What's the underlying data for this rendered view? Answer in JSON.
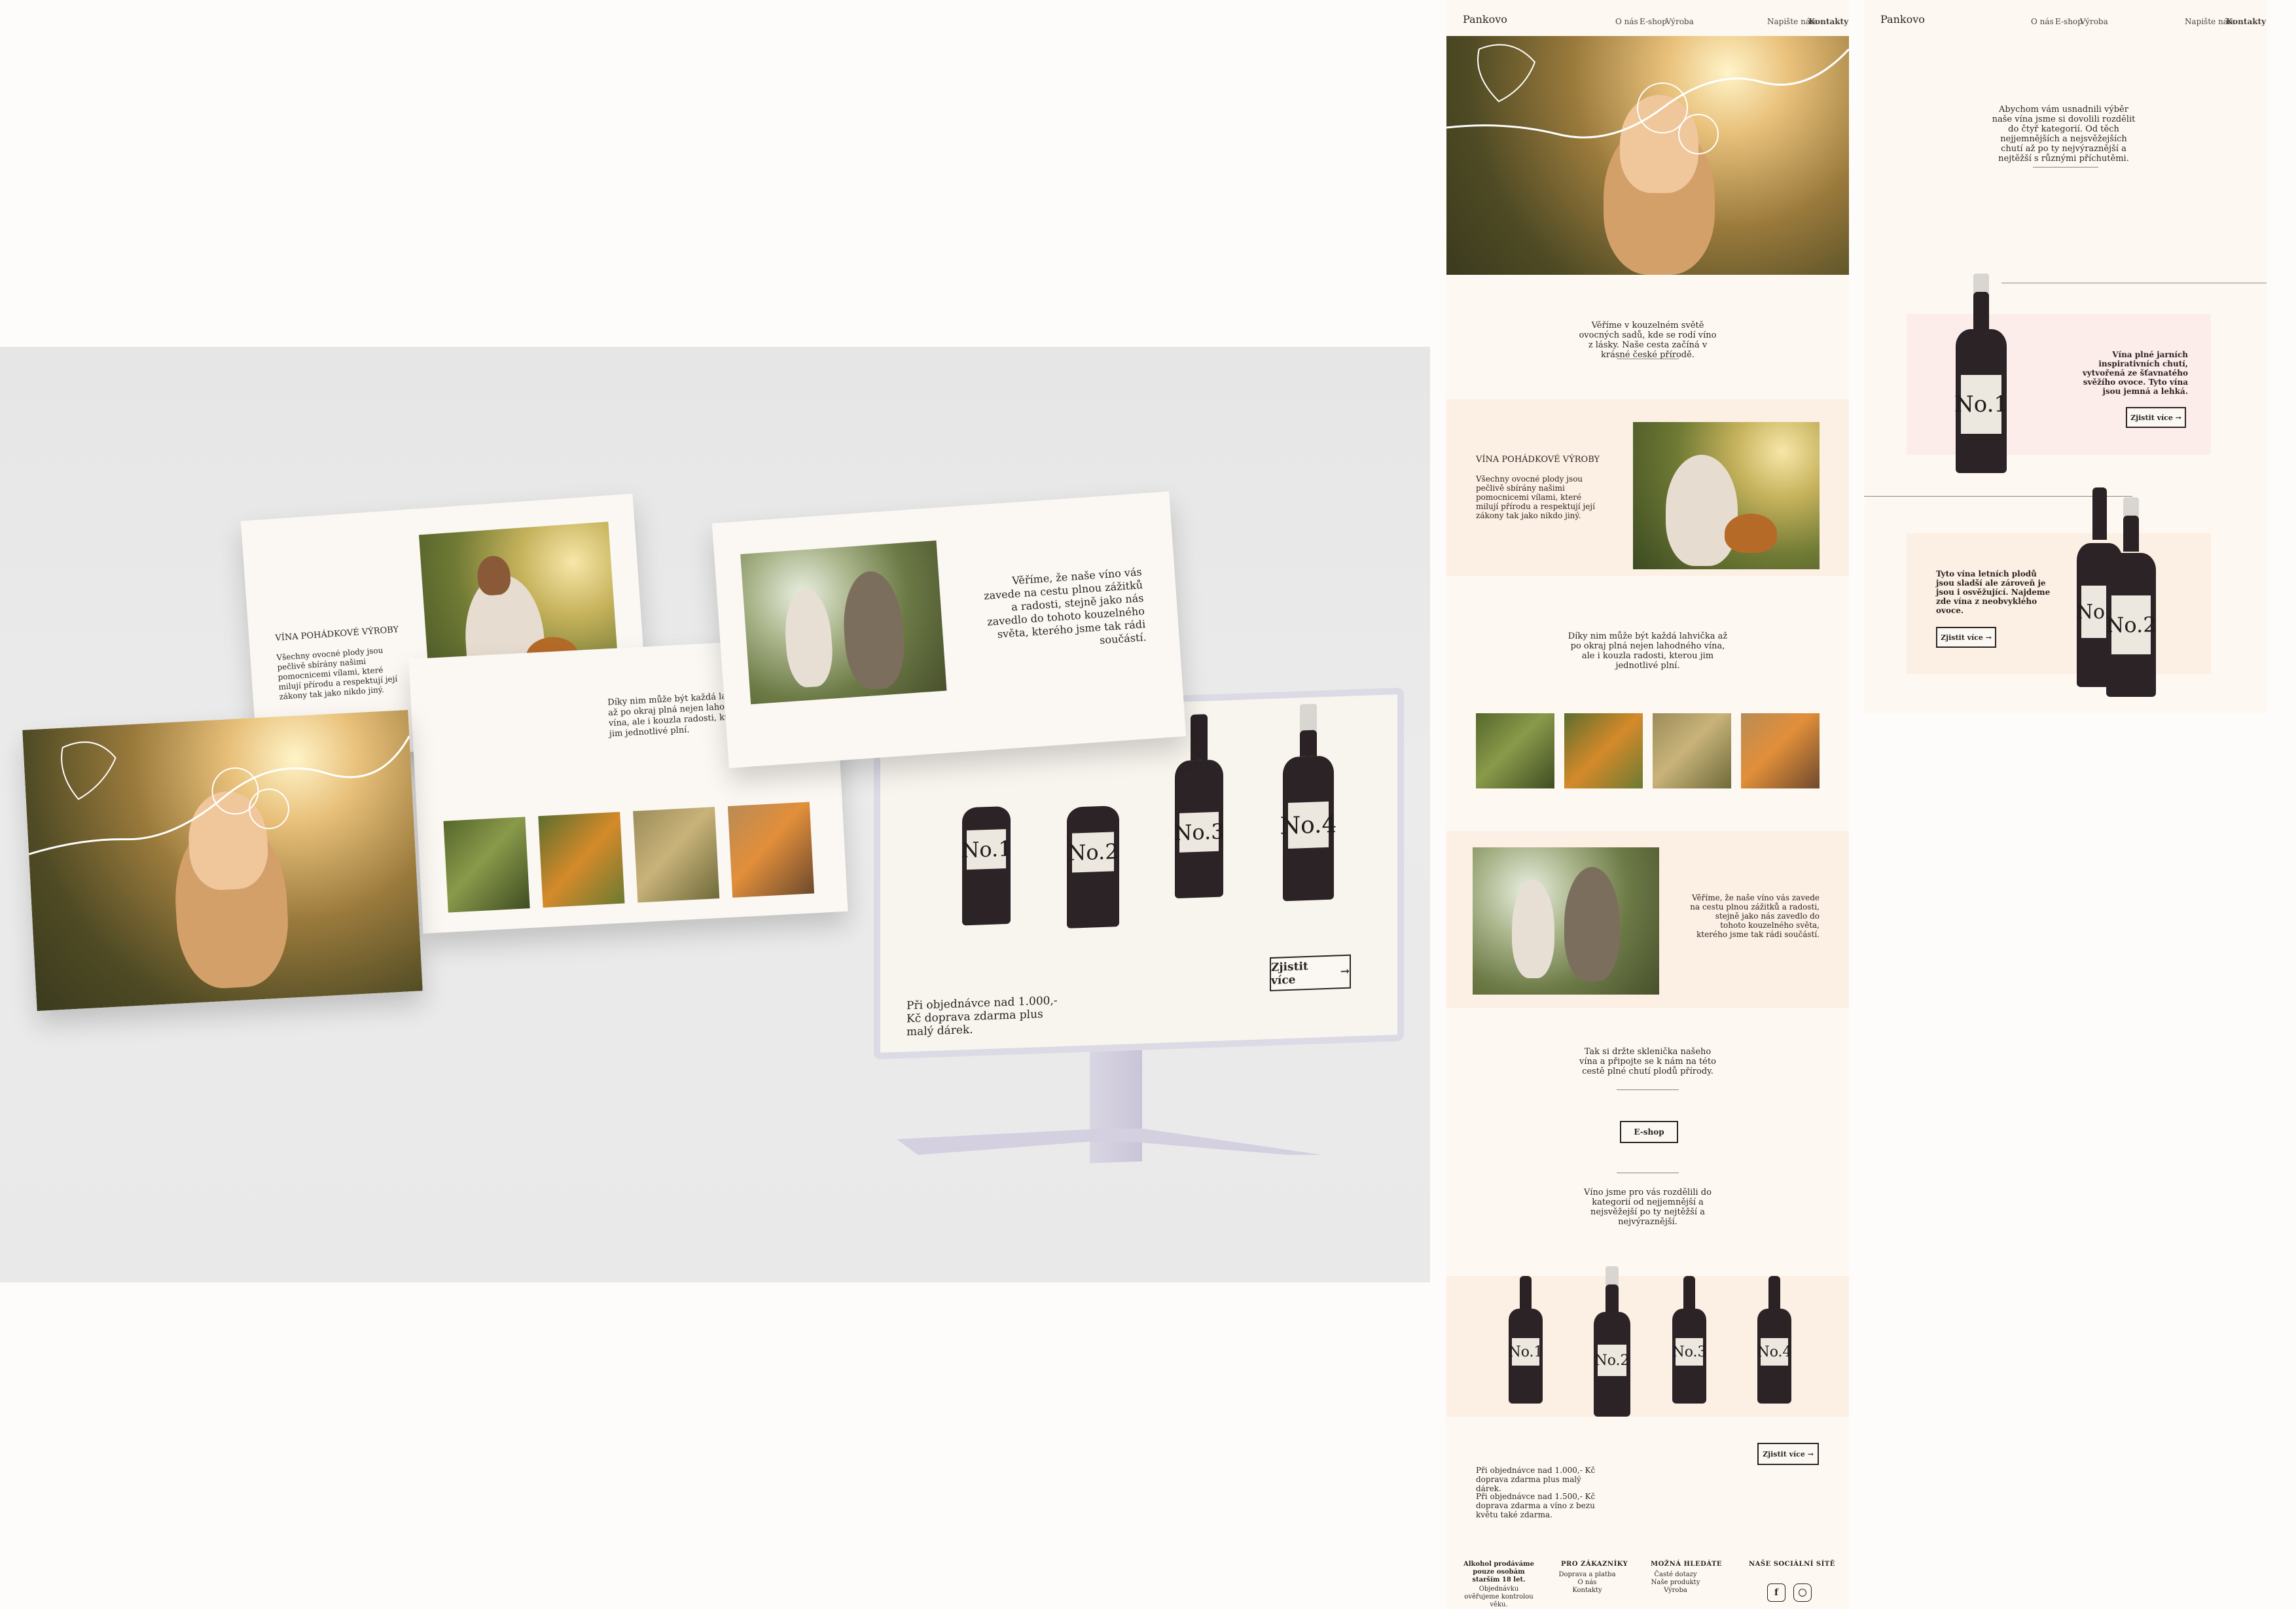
{
  "brand": "Pankovo",
  "nav": {
    "home": "O nás",
    "shop": "E-shop",
    "production": "Výroba",
    "write": "Napište nám",
    "contacts": "Kontakty"
  },
  "hero_intro": "Věříme v kouzelném světě ovocných sadů, kde se rodí víno z lásky. Naše cesta začíná v krásné české přírodě.",
  "fairy": {
    "title": "VÍNA POHÁDKOVÉ VÝROBY",
    "body": "Všechny ovocné plody jsou pečlivě sbírány našimi pomocnicemi vílami, které milují přírodu a respektují její zákony tak jako nikdo jiný."
  },
  "every_bottle": "Díky nim může být každá lahvička až po okraj plná nejen lahodného vína, ale i kouzla radosti, kterou jim jednotlivé plní.",
  "believe": "Věříme, že naše víno vás zavede na cestu plnou zážitků a radosti, stejně jako nás zavedlo do tohoto kouzelného světa, kterého jsme tak rádi součástí.",
  "grab_glass": "Tak si držte sklenička našeho vína a připojte se k nám na této cestě plné chutí plodů přírody.",
  "eshop_button": "E-shop",
  "categories_intro": "Víno jsme pro vás rozdělili do kategorií od nejjemnější a nejsvěžejší po ty nejtěžší a nejvýraznější.",
  "bottles": [
    "No.1",
    "No.2",
    "No.3",
    "No.4"
  ],
  "more_button": "Zjistit více",
  "shipping_1": "Při objednávce nad 1.000,- Kč doprava zdarma plus malý dárek.",
  "shipping_2": "Při objednávce nad 1.500,- Kč doprava zdarma a víno z bezu květu také zdarma.",
  "footer": {
    "col1_title": "Alkohol prodáváme pouze osobám starším 18 let.",
    "col1_text": "Objednávku ověřujeme kontrolou věku.",
    "col2_title": "PRO ZÁKAZNÍKY",
    "col2_items": [
      "Doprava a platba",
      "O nás",
      "Kontakty"
    ],
    "col3_title": "MOŽNÁ HLEDÁTE",
    "col3_items": [
      "Časté dotazy",
      "Naše produkty",
      "Výroba"
    ],
    "col4_title": "NAŠE SOCIÁLNÍ SÍTĚ"
  },
  "page2": {
    "intro": "Abychom vám usnadnili výběr naše vína jsme si dovolili rozdělit do čtyř kategorií. Od těch nejjemnějších a nejsvěžejších chutí až po ty nejvýraznější a nejtěžší s různými příchutěmi.",
    "spring": "Vína plné jarních inspirativních chutí, vytvořená ze šťavnatého svěžího ovoce. Tyto vína jsou jemná a lehká.",
    "summer": "Tyto vína letních plodů jsou sladší ale zároveň je jsou i osvěžující. Najdeme zde vína z neobvyklého ovoce."
  },
  "monitor": {
    "shipping": "Při objednávce nad 1.000,- Kč doprava zdarma plus malý dárek.",
    "button": "Zjistit více"
  },
  "colors": {
    "background": "#fdfcfa",
    "peach": "#fcefe3",
    "pink": "#fcecea",
    "ink": "#2a2422",
    "bottle": "#2b2326"
  }
}
